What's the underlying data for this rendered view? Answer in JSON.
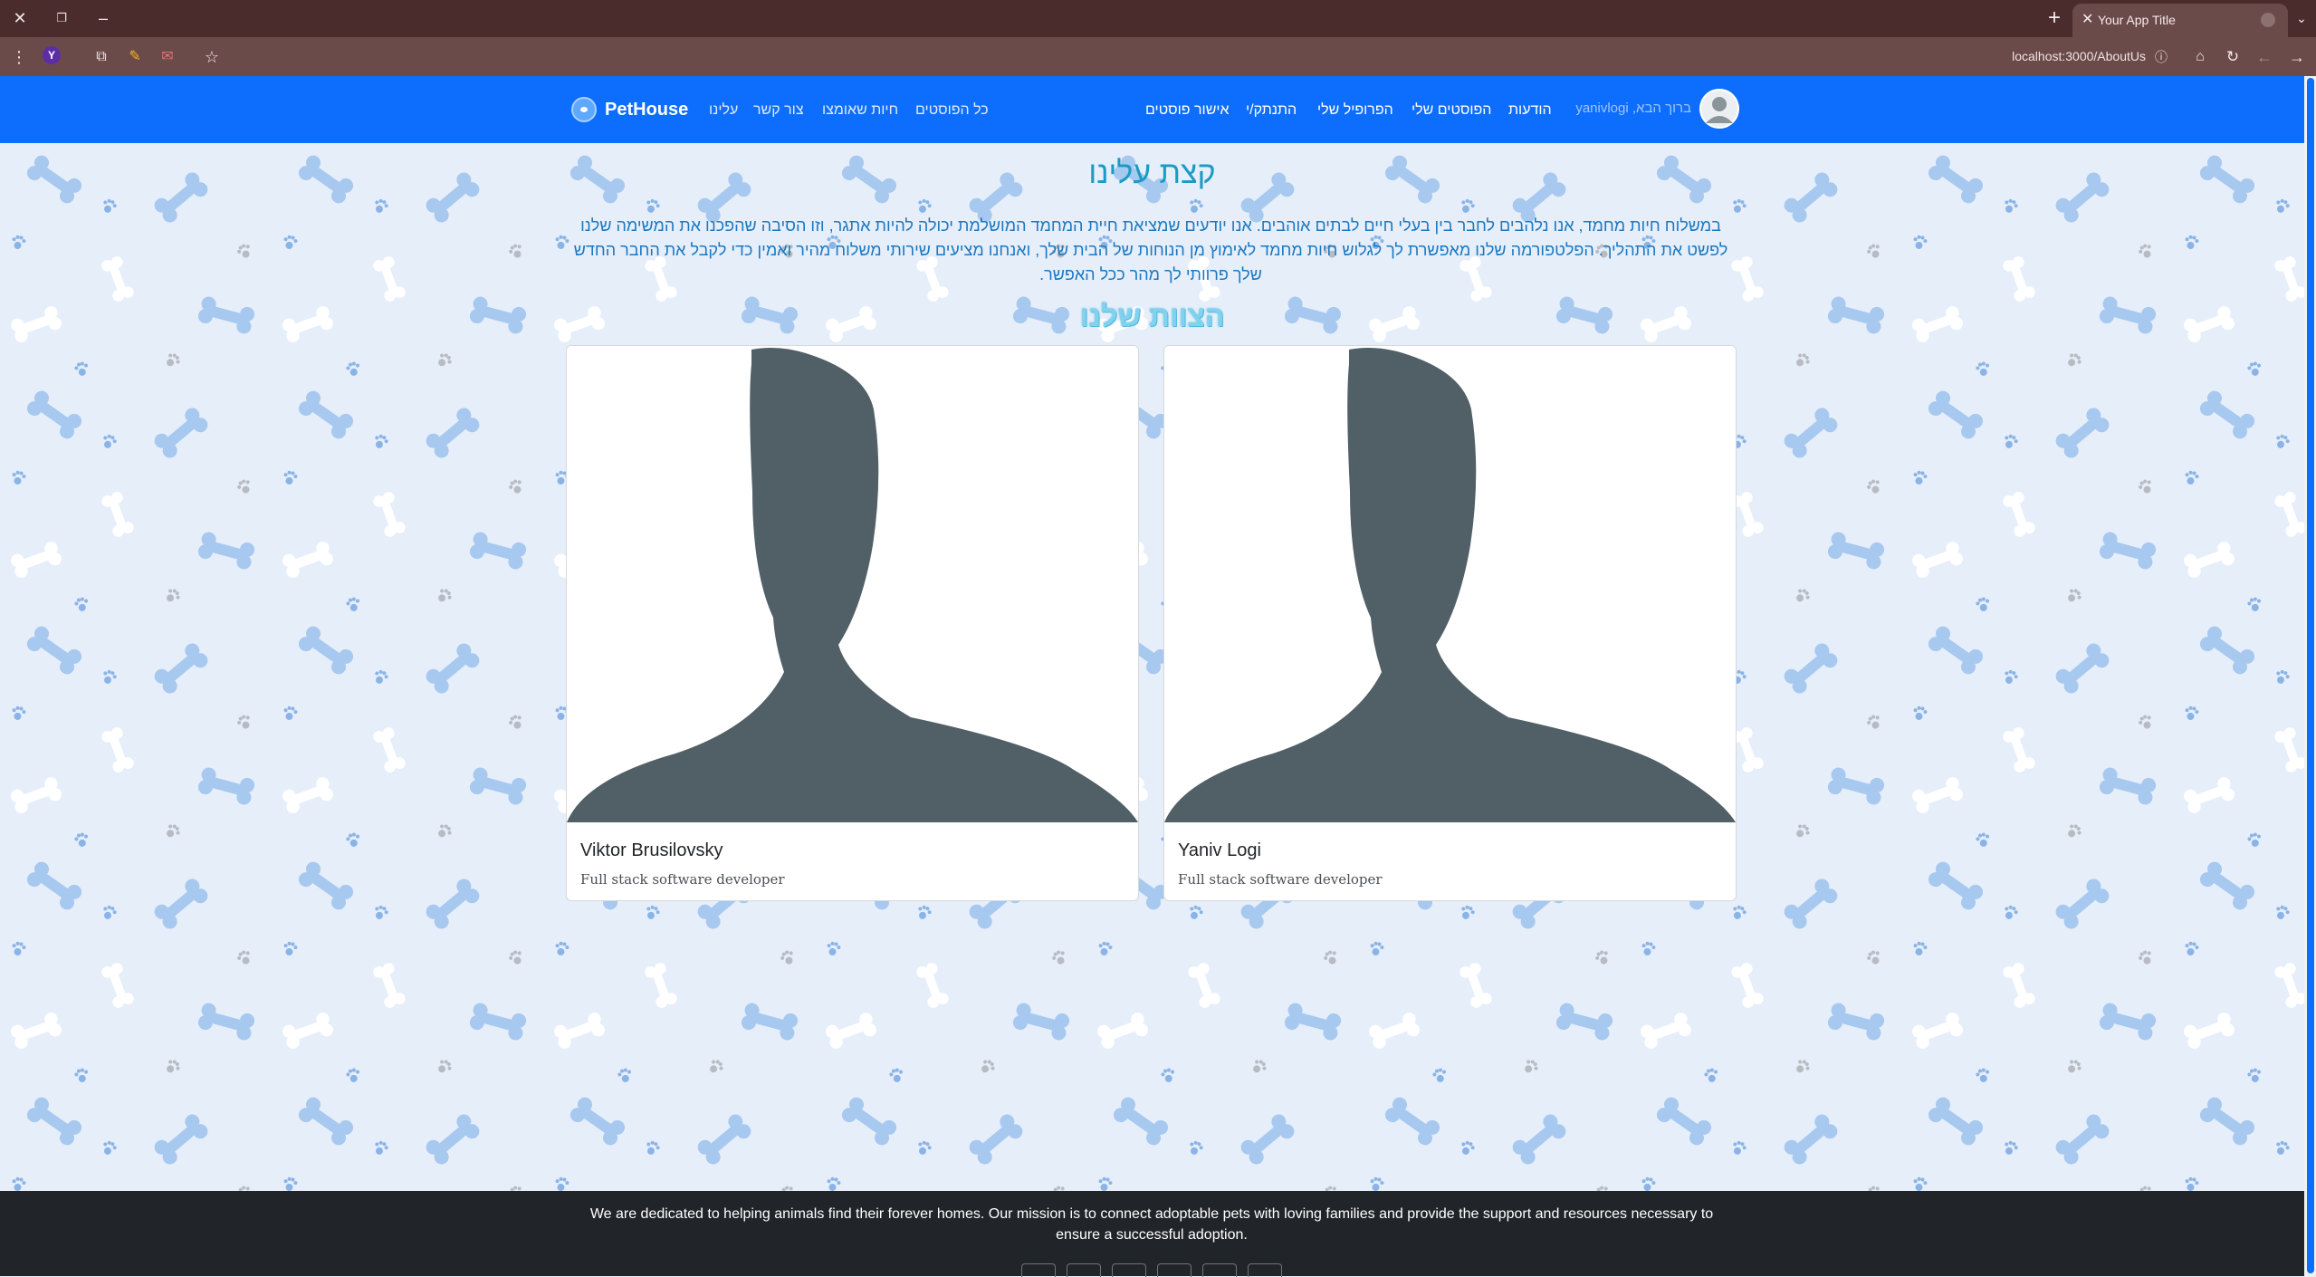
{
  "browser": {
    "tab_title": "Your App Title",
    "url": "localhost:3000/AboutUs",
    "extension_letter": "Y"
  },
  "navbar": {
    "brand": "PetHouse",
    "left_links": [
      "כל הפוסטים",
      "חיות שאומצו",
      "צור קשר",
      "עלינו"
    ],
    "right_links": [
      "אישור פוסטים",
      "התנתק/י",
      "הפרופיל שלי",
      "הפוסטים שלי",
      "הודעות"
    ],
    "greeting": "yanivlogi ,ברוך הבא"
  },
  "about": {
    "title": "קצת עלינו",
    "text": "במשלוח חיות מחמד, אנו נלהבים לחבר בין בעלי חיים לבתים אוהבים. אנו יודעים שמציאת חיית המחמד המושלמת יכולה להיות אתגר, וזו הסיבה שהפכנו את המשימה שלנו לפשט את התהליך. הפלטפורמה שלנו מאפשרת לך לגלוש חיות מחמד לאימוץ מן הנוחות של הבית שלך, ואנחנו מציעים שירותי משלוח מהיר ואמין כדי לקבל את החבר החדש שלך פרוותי לך מהר ככל האפשר.",
    "team_title": "הצוות שלנו"
  },
  "team": [
    {
      "name": "Viktor Brusilovsky",
      "role": "Full stack software developer"
    },
    {
      "name": "Yaniv Logi",
      "role": "Full stack software developer"
    }
  ],
  "footer": {
    "text": "We are dedicated to helping animals find their forever homes. Our mission is to connect adoptable pets with loving families and provide the support and resources necessary to ensure a successful adoption."
  },
  "colors": {
    "navbar": "#0d6efd",
    "footer": "#212529",
    "title": "#1a9bc4",
    "silhouette": "#515f66"
  },
  "icons": [
    "close-icon",
    "restore-icon",
    "minimize-icon",
    "new-tab-icon",
    "menu-icon",
    "extensions-icon",
    "bookmark-star-icon",
    "home-icon",
    "reload-icon",
    "back-icon",
    "forward-icon",
    "info-icon"
  ]
}
